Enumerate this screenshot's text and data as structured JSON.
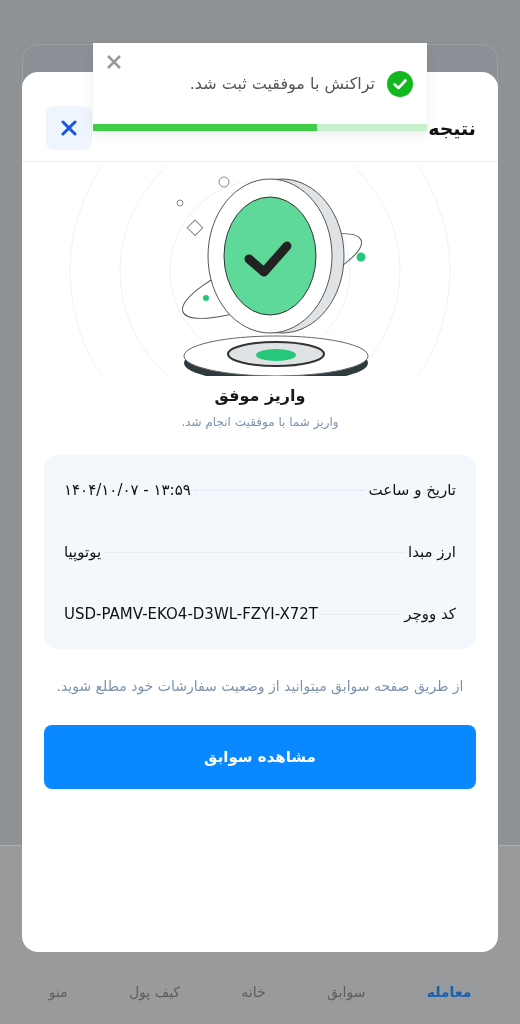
{
  "toast": {
    "message": "تراکنش با موفقیت ثبت شد.",
    "level": 0.67
  },
  "modal": {
    "title": "نتیجه",
    "heading": "واریز موفق",
    "subtitle": "واریز شما با موفقیت انجام شد.",
    "details": [
      {
        "label": "تاریخ و ساعت",
        "value": "۱۴۰۴/۱۰/۰۷ - ۱۳:۵۹"
      },
      {
        "label": "ارز مبدا",
        "value": "یوتوپیا"
      },
      {
        "label": "کد ووچر",
        "value": "USD-PAMV-EKO4-D3WL-FZYI-X72T"
      }
    ],
    "note": "از طریق صفحه سوابق میتوانید از وضعیت سفارشات خود مطلع شوید.",
    "button": "مشاهده سوابق"
  },
  "bottom_nav": [
    {
      "label": "معامله",
      "selected": true
    },
    {
      "label": "سوابق",
      "selected": false
    },
    {
      "label": "خانه",
      "selected": false
    },
    {
      "label": "کیف پول",
      "selected": false
    },
    {
      "label": "منو",
      "selected": false
    }
  ]
}
